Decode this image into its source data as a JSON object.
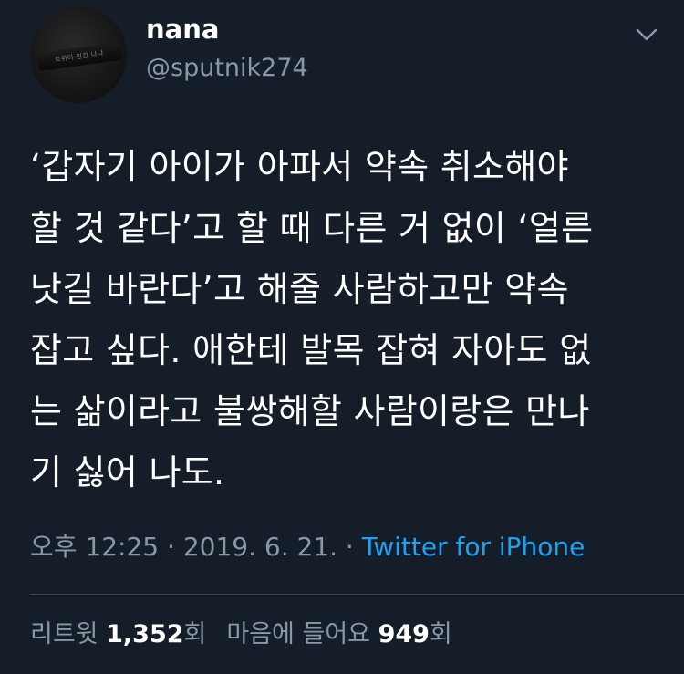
{
  "user": {
    "avatar_text": "트위터 인간 나나",
    "display_name": "nana",
    "handle": "@sputnik274"
  },
  "header": {
    "menu_icon": "chevron-down-icon"
  },
  "tweet": {
    "text": "‘갑자기 아이가 아파서 약속 취소해야\n할 것 같다’고 할 때 다른 거 없이 ‘얼른\n낫길 바란다’고 해줄 사람하고만 약속\n잡고 싶다. 애한테 발목 잡혀 자아도 없\n는 삶이라고 불쌍해할 사람이랑은 만나\n기 싫어 나도."
  },
  "meta": {
    "time": "오후 12:25",
    "separator1": " · ",
    "date": "2019. 6. 21.",
    "separator2": " · ",
    "source": "Twitter for iPhone"
  },
  "stats": {
    "retweets_label": "리트윗",
    "retweets_count": "1,352",
    "retweets_unit": "회",
    "likes_label": "마음에 들어요",
    "likes_count": "949",
    "likes_unit": "회"
  },
  "colors": {
    "background": "#151d29",
    "primary_text": "#ffffff",
    "secondary_text": "#8899a6",
    "link": "#1da1f2",
    "divider": "#38444d"
  }
}
